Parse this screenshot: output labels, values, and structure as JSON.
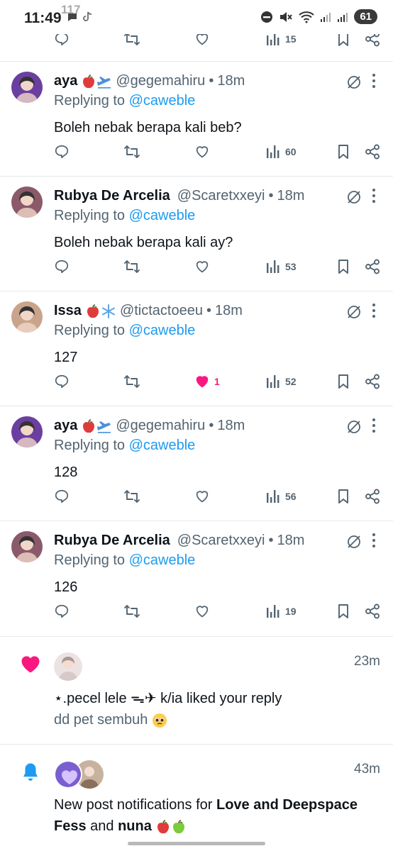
{
  "status_bar": {
    "time": "11:49",
    "ghost_text": "117",
    "battery": "61"
  },
  "top_actions": {
    "views": "15"
  },
  "tweets": [
    {
      "name": "aya",
      "name_emojis": [
        "red-apple",
        "airplane-departure"
      ],
      "handle": "@gegemahiru",
      "sep": "•",
      "time": "18m",
      "replying_prefix": "Replying to",
      "replying_to": "@caweble",
      "text": "Boleh nebak berapa kali beb?",
      "likes": "",
      "liked": false,
      "views": "60",
      "avatar_color": "#6b3fa0"
    },
    {
      "name": "Rubya De Arcelia",
      "name_emojis": [],
      "handle": "@Scaretxxeyi",
      "sep": "•",
      "time": "18m",
      "replying_prefix": "Replying to",
      "replying_to": "@caweble",
      "text": "Boleh nebak berapa kali ay?",
      "likes": "",
      "liked": false,
      "views": "53",
      "avatar_color": "#8a5a6a"
    },
    {
      "name": "Issa",
      "name_emojis": [
        "red-apple",
        "snowflake"
      ],
      "handle": "@tictactoeeu",
      "sep": "•",
      "time": "18m",
      "replying_prefix": "Replying to",
      "replying_to": "@caweble",
      "text": "127",
      "likes": "1",
      "liked": true,
      "views": "52",
      "avatar_color": "#c9a48a"
    },
    {
      "name": "aya",
      "name_emojis": [
        "red-apple",
        "airplane-departure"
      ],
      "handle": "@gegemahiru",
      "sep": "•",
      "time": "18m",
      "replying_prefix": "Replying to",
      "replying_to": "@caweble",
      "text": "128",
      "likes": "",
      "liked": false,
      "views": "56",
      "avatar_color": "#6b3fa0"
    },
    {
      "name": "Rubya De Arcelia",
      "name_emojis": [],
      "handle": "@Scaretxxeyi",
      "sep": "•",
      "time": "18m",
      "replying_prefix": "Replying to",
      "replying_to": "@caweble",
      "text": "126",
      "likes": "",
      "liked": false,
      "views": "19",
      "avatar_color": "#8a5a6a"
    }
  ],
  "notifications": [
    {
      "type": "like",
      "time": "23m",
      "text": "⋆.pecel lele ᯓ✈ k/ia liked your reply",
      "sub": "dd pet sembuh",
      "sub_emoji": "pleading-face",
      "avatar_color": "#e8dede"
    },
    {
      "type": "bell",
      "time": "43m",
      "text_plain": "New post notifications for ",
      "text_bold_1": "Love and Deepspace Fess",
      "text_mid": " and ",
      "text_bold_2": "nuna",
      "trailing_emojis": [
        "red-apple",
        "green-apple"
      ],
      "avatar_colors": [
        "#7a5fd0",
        "#c7b2a0"
      ]
    }
  ],
  "colors": {
    "accent": "#1d9bf0",
    "like_pink": "#f91880",
    "secondary_text": "#536471",
    "bell_blue": "#1d9bf0"
  }
}
